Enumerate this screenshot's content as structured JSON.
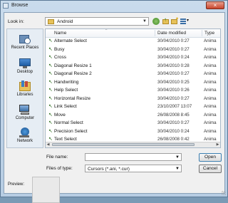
{
  "window": {
    "title": "Browse"
  },
  "toolbar": {
    "look_in_label": "Look in:",
    "look_in_value": "Android"
  },
  "places": [
    {
      "label": "Recent Places"
    },
    {
      "label": "Desktop"
    },
    {
      "label": "Libraries"
    },
    {
      "label": "Computer"
    },
    {
      "label": "Network"
    }
  ],
  "list": {
    "columns": {
      "name": "Name",
      "date": "Date modified",
      "type": "Type"
    },
    "rows": [
      {
        "name": "Alternate Select",
        "date": "30/04/2010 0:27",
        "type": "Anima"
      },
      {
        "name": "Busy",
        "date": "30/04/2010 0:27",
        "type": "Anima"
      },
      {
        "name": "Cross",
        "date": "30/04/2010 0:24",
        "type": "Anima"
      },
      {
        "name": "Diagonal Resize 1",
        "date": "30/04/2010 0:28",
        "type": "Anima"
      },
      {
        "name": "Diagonal Resize 2",
        "date": "30/04/2010 0:27",
        "type": "Anima"
      },
      {
        "name": "Handwriting",
        "date": "30/04/2010 0:25",
        "type": "Anima"
      },
      {
        "name": "Help Select",
        "date": "30/04/2010 0:26",
        "type": "Anima"
      },
      {
        "name": "Horizontal Resize",
        "date": "30/04/2010 0:27",
        "type": "Anima"
      },
      {
        "name": "Link Select",
        "date": "23/10/2007 13:07",
        "type": "Anima"
      },
      {
        "name": "Move",
        "date": "26/08/2008 8:45",
        "type": "Anima"
      },
      {
        "name": "Normal Select",
        "date": "30/04/2010 0:27",
        "type": "Anima"
      },
      {
        "name": "Precision Select",
        "date": "30/04/2010 0:24",
        "type": "Anima"
      },
      {
        "name": "Text Select",
        "date": "26/08/2008 0:42",
        "type": "Anima"
      }
    ]
  },
  "footer": {
    "file_name_label": "File name:",
    "file_name_value": "",
    "file_type_label": "Files of type:",
    "file_type_value": "Cursors (*.ani, *.cur)",
    "open_label": "Open",
    "cancel_label": "Cancel",
    "preview_label": "Preview:"
  }
}
